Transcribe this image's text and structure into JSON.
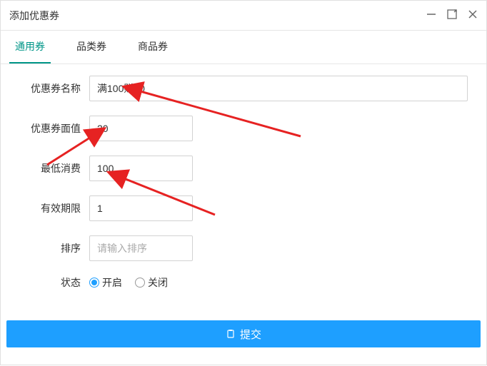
{
  "dialog": {
    "title": "添加优惠券"
  },
  "tabs": [
    {
      "label": "通用券",
      "active": true
    },
    {
      "label": "品类券",
      "active": false
    },
    {
      "label": "商品券",
      "active": false
    }
  ],
  "form": {
    "name": {
      "label": "优惠券名称",
      "value": "满100赠20"
    },
    "faceValue": {
      "label": "优惠券面值",
      "value": "20"
    },
    "minSpend": {
      "label": "最低消费",
      "value": "100"
    },
    "validity": {
      "label": "有效期限",
      "value": "1"
    },
    "sort": {
      "label": "排序",
      "value": "",
      "placeholder": "请输入排序"
    },
    "status": {
      "label": "状态",
      "options": {
        "open": "开启",
        "close": "关闭"
      },
      "value": "open"
    }
  },
  "actions": {
    "submit": "提交"
  },
  "colors": {
    "primary": "#1E9FFF",
    "accent": "#009688",
    "border": "#e6e6e6"
  }
}
